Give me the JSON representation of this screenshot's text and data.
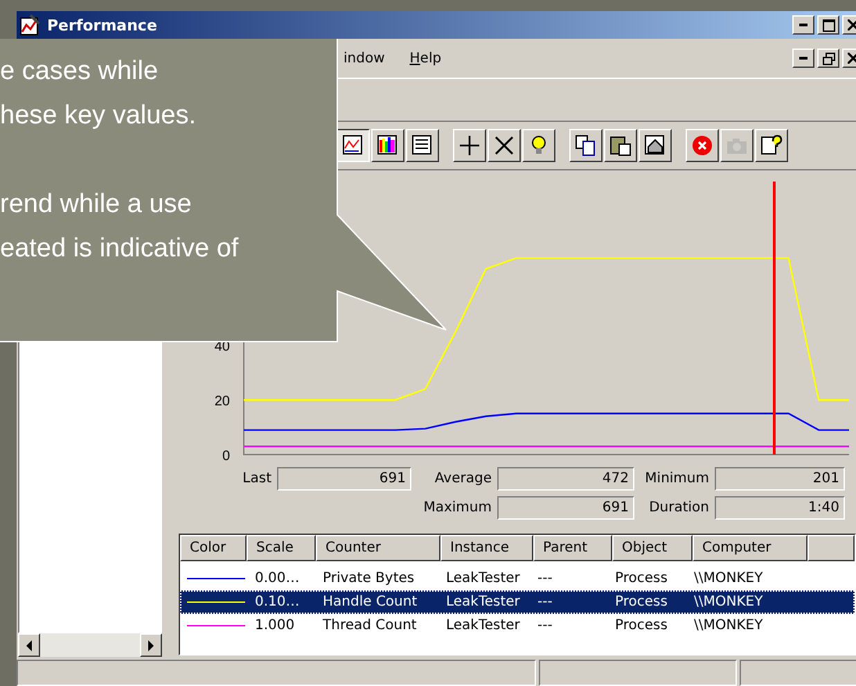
{
  "window": {
    "title": "Performance"
  },
  "menu": [
    {
      "label": "indow",
      "mnemonic": false
    },
    {
      "label": "Help",
      "mnemonic": true
    }
  ],
  "toolbar": [
    {
      "kind": "graph",
      "selected": true
    },
    {
      "kind": "histogram",
      "selected": false
    },
    {
      "kind": "report",
      "selected": false
    },
    {
      "kind": "add",
      "selected": false
    },
    {
      "kind": "delete",
      "selected": false
    },
    {
      "kind": "highlight",
      "selected": false
    },
    {
      "kind": "copy",
      "selected": false
    },
    {
      "kind": "paste",
      "selected": false
    },
    {
      "kind": "properties",
      "selected": false
    },
    {
      "kind": "freeze",
      "selected": false
    },
    {
      "kind": "update",
      "selected": false,
      "disabled": true
    },
    {
      "kind": "help",
      "selected": false
    }
  ],
  "chart": {
    "chart_data": {
      "type": "line",
      "ylim": [
        0,
        100
      ],
      "yticks": [
        0,
        20,
        40
      ],
      "series": [
        {
          "color": "#0000ff",
          "values": [
            9,
            9,
            9,
            9,
            9,
            9,
            9.5,
            12,
            14,
            15,
            15,
            15,
            15,
            15,
            15,
            15,
            15,
            15,
            15,
            9,
            9
          ]
        },
        {
          "color": "#ffff00",
          "values": [
            20,
            20,
            20,
            20,
            20,
            20,
            24,
            45,
            68,
            72,
            72,
            72,
            72,
            72,
            72,
            72,
            72,
            72,
            72,
            20,
            20
          ]
        },
        {
          "color": "#ff00ff",
          "values": [
            3,
            3,
            3,
            3,
            3,
            3,
            3,
            3,
            3,
            3,
            3,
            3,
            3,
            3,
            3,
            3,
            3,
            3,
            3,
            3,
            3
          ]
        }
      ]
    }
  },
  "stats": [
    {
      "label": "Last",
      "value": "691"
    },
    {
      "label": "Average",
      "value": "472"
    },
    {
      "label": "Minimum",
      "value": "201"
    },
    {
      "label": "Maximum",
      "value": "691"
    },
    {
      "label": "Duration",
      "value": "1:40"
    }
  ],
  "legend": {
    "columns": [
      "Color",
      "Scale",
      "Counter",
      "Instance",
      "Parent",
      "Object",
      "Computer"
    ],
    "rows": [
      {
        "color": "#0000ff",
        "scale": "0.00…",
        "counter": "Private Bytes",
        "instance": "LeakTester",
        "parent": "---",
        "object": "Process",
        "computer": "\\\\MONKEY",
        "selected": false
      },
      {
        "color": "#ffff00",
        "scale": "0.10…",
        "counter": "Handle Count",
        "instance": "LeakTester",
        "parent": "---",
        "object": "Process",
        "computer": "\\\\MONKEY",
        "selected": true
      },
      {
        "color": "#ff00ff",
        "scale": "1.000",
        "counter": "Thread Count",
        "instance": "LeakTester",
        "parent": "---",
        "object": "Process",
        "computer": "\\\\MONKEY",
        "selected": false
      }
    ]
  },
  "callout": {
    "paragraphs": [
      [
        "e cases while",
        "hese key values."
      ],
      [
        "rend while a use",
        "eated is indicative of"
      ]
    ]
  }
}
